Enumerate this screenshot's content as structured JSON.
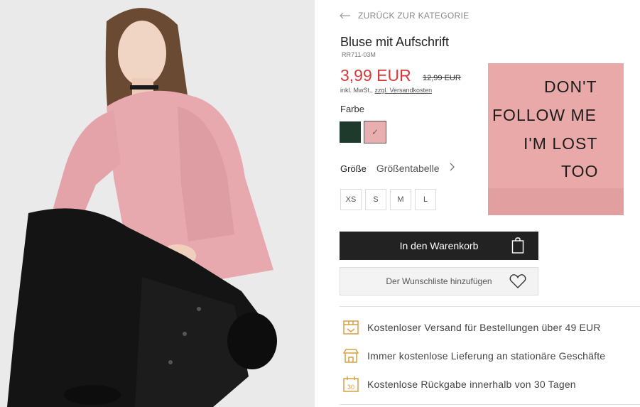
{
  "nav": {
    "back_label": "ZURÜCK ZUR KATEGORIE"
  },
  "product": {
    "title": "Bluse mit Aufschrift",
    "sku": "RR711-03M",
    "price": "3,99 EUR",
    "old_price": "12,99 EUR",
    "vat_text": "inkl. MwSt.,",
    "shipping_link": "zzgl. Versandkosten",
    "print_text": [
      "DON'T",
      "FOLLOW ME",
      "I'M LOST",
      "TOO"
    ]
  },
  "colors": {
    "label": "Farbe",
    "options": [
      {
        "name": "green",
        "hex": "#1e3a2d"
      },
      {
        "name": "pink",
        "hex": "#e9aeb0",
        "selected": true
      }
    ]
  },
  "sizes": {
    "label": "Größe",
    "table_link": "Größentabelle",
    "options": [
      "XS",
      "S",
      "M",
      "L"
    ]
  },
  "actions": {
    "cart_label": "In den Warenkorb",
    "wishlist_label": "Der Wunschliste hinzufügen"
  },
  "benefits": [
    {
      "icon": "shipping-box-icon",
      "text": "Kostenloser Versand für Bestellungen über 49 EUR"
    },
    {
      "icon": "store-icon",
      "text": "Immer kostenlose Lieferung an stationäre Geschäfte"
    },
    {
      "icon": "calendar-30-icon",
      "text": "Kostenlose Rückgabe innerhalb von 30 Tagen",
      "icon_text": "30"
    }
  ],
  "accent": "#d63a3a",
  "icon_color": "#d8a040"
}
